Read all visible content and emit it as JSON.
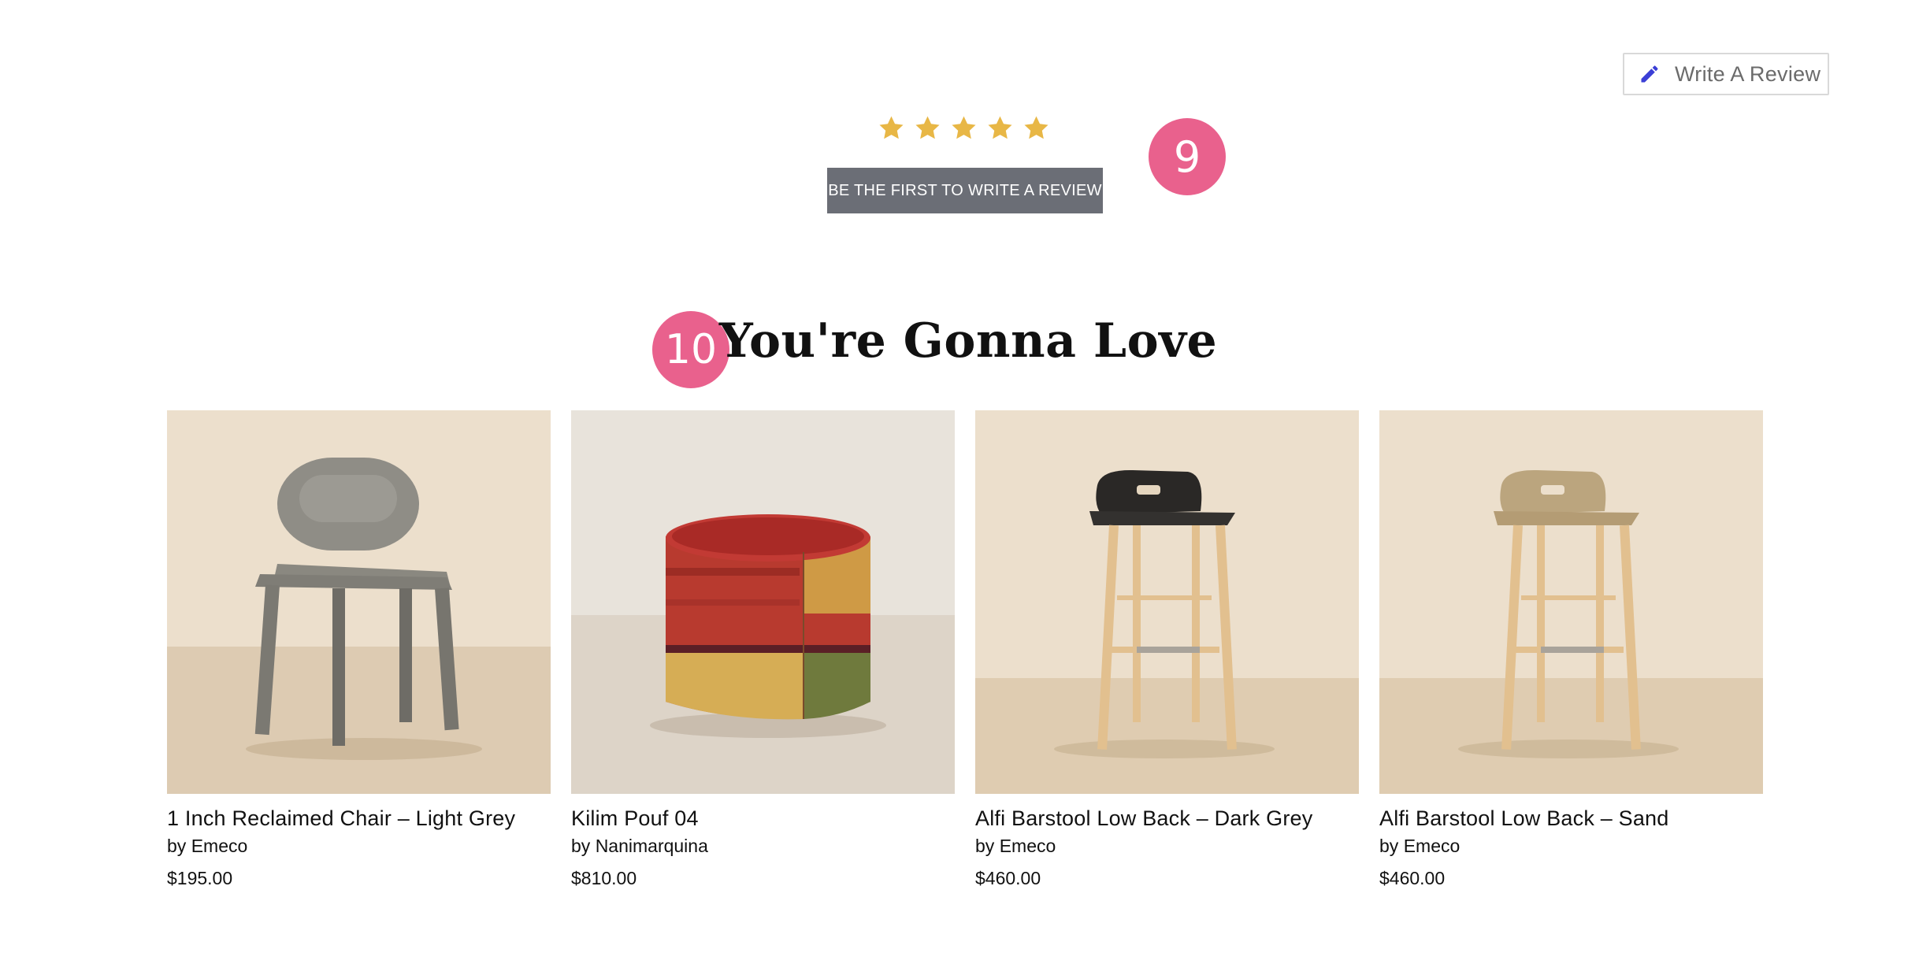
{
  "reviews": {
    "write_review_label": "Write A Review",
    "rating_stars": 5,
    "first_review_label": "BE THE FIRST TO WRITE A REVIEW",
    "star_color": "#e8b746"
  },
  "markers": {
    "m9": "9",
    "m10": "10",
    "color": "#e9618d"
  },
  "section": {
    "title": "You're Gonna Love"
  },
  "products": [
    {
      "name": "1 Inch Reclaimed Chair – Light Grey",
      "by": "by",
      "brand": "Emeco",
      "price": "$195.00"
    },
    {
      "name": "Kilim Pouf 04",
      "by": "by",
      "brand": "Nanimarquina",
      "price": "$810.00"
    },
    {
      "name": "Alfi Barstool Low Back – Dark Grey",
      "by": "by",
      "brand": "Emeco",
      "price": "$460.00"
    },
    {
      "name": "Alfi Barstool Low Back – Sand",
      "by": "by",
      "brand": "Emeco",
      "price": "$460.00"
    }
  ],
  "colors": {
    "accent_blue": "#3b3fd6",
    "button_grey": "#6b6e76"
  }
}
